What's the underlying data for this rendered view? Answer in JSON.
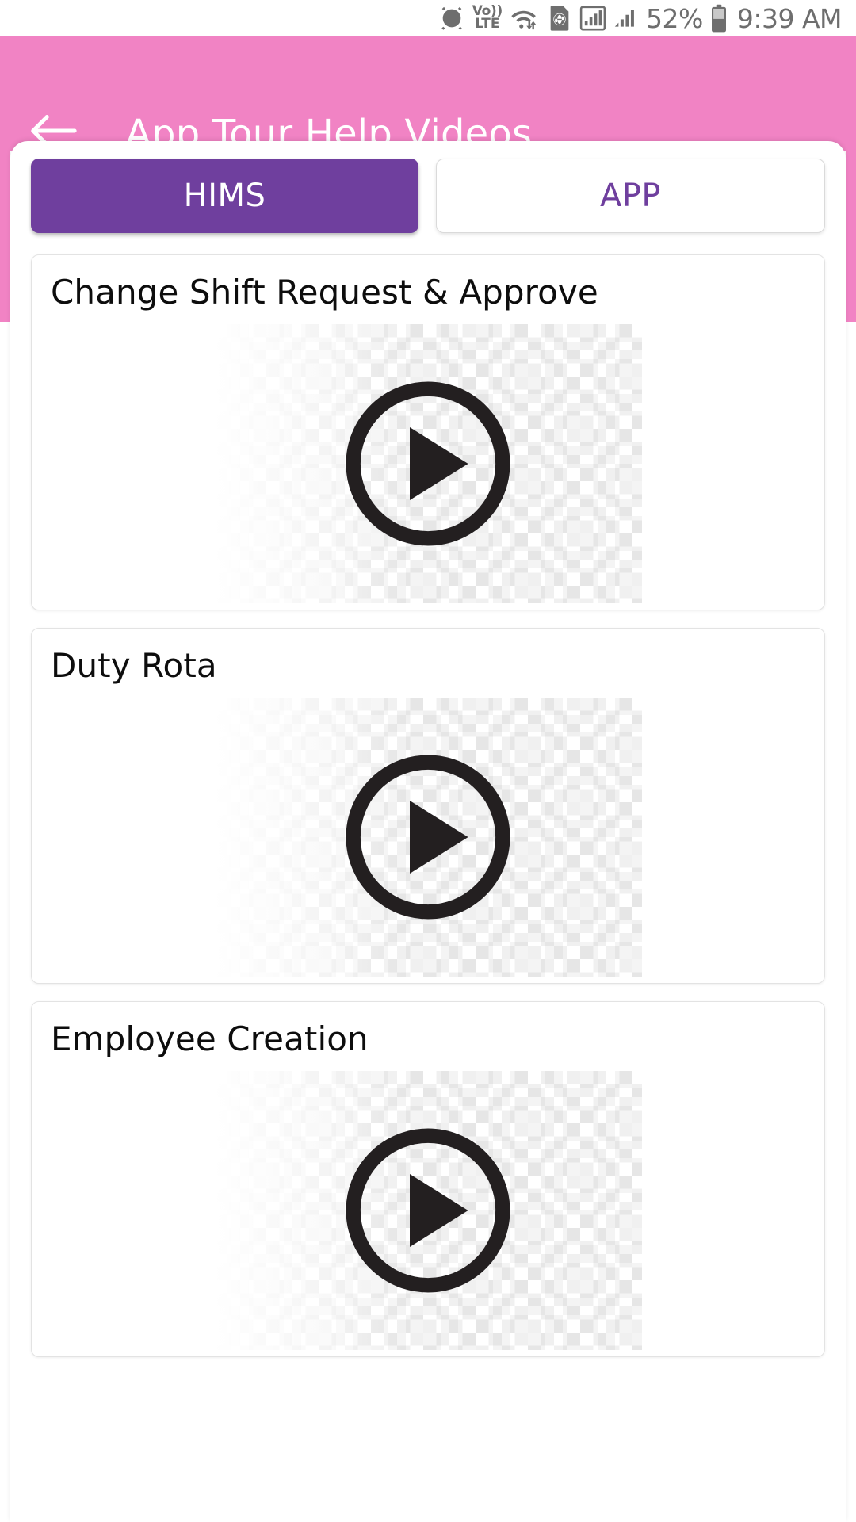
{
  "status_bar": {
    "icons": [
      "alarm-icon",
      "volte-icon",
      "wifi-icon",
      "sim-globe-icon",
      "signal-sim1-icon",
      "signal-sim2-icon"
    ],
    "volte_line1": "Vo))",
    "volte_line2": "LTE",
    "battery_percent": "52%",
    "time": "9:39 AM"
  },
  "appbar": {
    "back_icon": "back-arrow-icon",
    "title": "App Tour Help Videos",
    "background_color": "#f183c4",
    "title_color": "#ffffff"
  },
  "tabs": {
    "accent_color": "#6f3f9e",
    "items": [
      {
        "label": "HIMS",
        "active": true
      },
      {
        "label": "APP",
        "active": false
      }
    ]
  },
  "videos": [
    {
      "title": "Change Shift Request & Approve",
      "thumbnail": "transparent-placeholder",
      "play_icon": "play-circle-icon"
    },
    {
      "title": "Duty Rota",
      "thumbnail": "transparent-placeholder",
      "play_icon": "play-circle-icon"
    },
    {
      "title": "Employee Creation",
      "thumbnail": "transparent-placeholder",
      "play_icon": "play-circle-icon"
    }
  ]
}
